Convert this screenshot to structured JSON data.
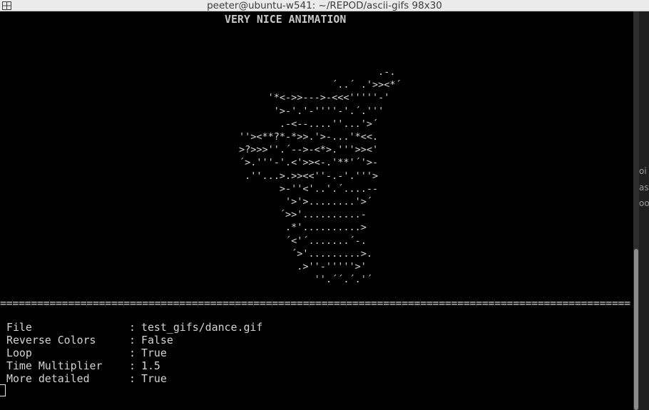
{
  "window": {
    "title": "peeter@ubuntu-w541: ~/REPOD/ascii-gifs 98x30",
    "split_icon": "split-window-icon"
  },
  "terminal": {
    "animation_title": "VERY NICE ANIMATION",
    "ascii_frame": "                                .-.\n                        ´..´ .'>><*´\n             '*<->>--->-<<<'''''-'\n              '>-'.'-''''-'.´.'''\n               .-<--....''...'>´\n        ''><**?*-*>>.'>-...'*<<.\n        >?>>>''.´-->-<*>.'''>><'\n        ´>.'''-'.<'>><-.'**'´'>-\n         .''...>.>><<''-.-'.'''>\n               >-''<'..'.´....--\n                '>'>........'>´\n               ´>>'..........-\n                .*'..........>\n                ´<'´.......´-.\n                 ´>'.........>.\n                  .>''-'''''>'\n                     ''.´´.´.'´",
    "separator": "=================================================================================================================",
    "info": [
      {
        "label": "File",
        "value": "test_gifs/dance.gif"
      },
      {
        "label": "Reverse Colors",
        "value": "False"
      },
      {
        "label": "Loop",
        "value": "True"
      },
      {
        "label": "Time Multiplier",
        "value": "1.5"
      },
      {
        "label": "More detailed",
        "value": "True"
      }
    ],
    "info_separator": ":"
  },
  "background_window": {
    "fragments": [
      "oi",
      "as",
      "oo"
    ]
  }
}
